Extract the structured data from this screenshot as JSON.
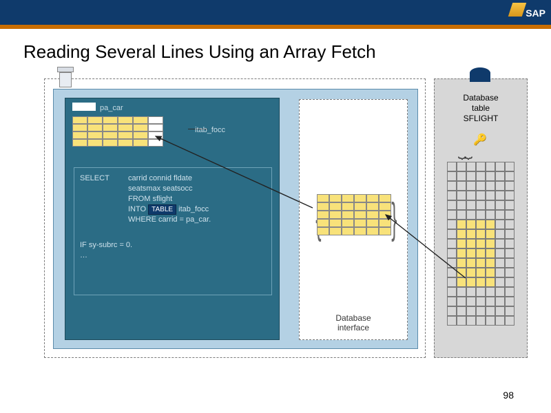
{
  "header": {
    "logo": "SAP",
    "title": "Reading Several Lines Using an Array Fetch"
  },
  "page_number": "98",
  "diagram": {
    "pa_car_label": "pa_car",
    "itab_label": "itab_focc",
    "db_interface_label": "Database\ninterface",
    "db_table_label": "Database\ntable\nSFLIGHT",
    "code": {
      "select": "SELECT",
      "fields1": "carrid connid fldate",
      "fields2": "seatsmax seatsocc",
      "from": "FROM sflight",
      "into_pre": "INTO",
      "into_badge": "TABLE",
      "into_post": "itab_focc",
      "where": "WHERE carrid = pa_car.",
      "if_line": "IF sy-subrc = 0.",
      "dots": "…"
    }
  }
}
